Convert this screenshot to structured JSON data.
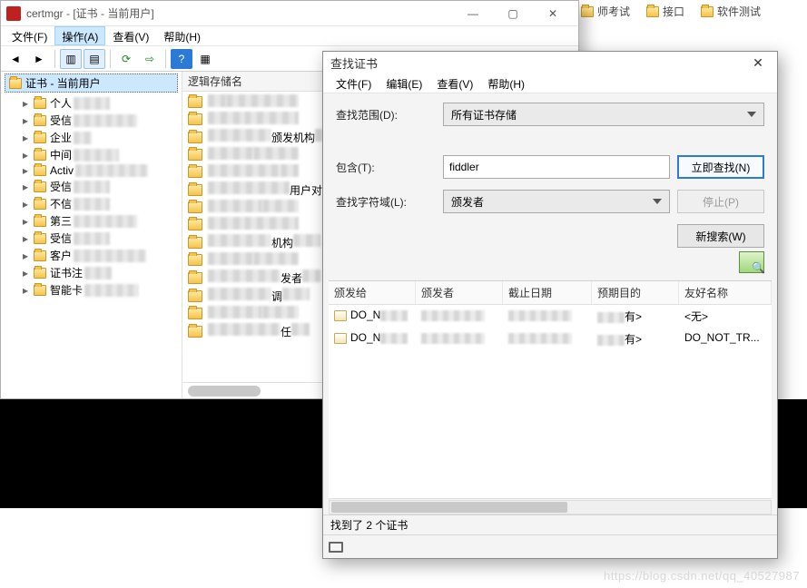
{
  "bookmarks": [
    "师考试",
    "接口",
    "软件测试"
  ],
  "certmgr": {
    "title": "certmgr - [证书 - 当前用户]",
    "menus": {
      "file": "文件(F)",
      "action": "操作(A)",
      "view": "查看(V)",
      "help": "帮助(H)"
    },
    "tree": {
      "root": "证书 - 当前用户",
      "items": [
        "个人",
        "受信",
        "企业",
        "中间",
        "Activ",
        "受信",
        "不信",
        "第三",
        "受信",
        "客户",
        "证书注",
        "智能卡"
      ]
    },
    "list": {
      "header": "逻辑存储名",
      "visible_labels": [
        "颁发机构",
        "用户对象",
        "机构",
        "发者",
        "调",
        "任"
      ]
    }
  },
  "finddlg": {
    "title": "查找证书",
    "menus": {
      "file": "文件(F)",
      "edit": "编辑(E)",
      "view": "查看(V)",
      "help": "帮助(H)"
    },
    "labels": {
      "scope": "查找范围(D):",
      "contains": "包含(T):",
      "field": "查找字符域(L):"
    },
    "scope_value": "所有证书存储",
    "contains_value": "fiddler",
    "field_value": "颁发者",
    "buttons": {
      "find_now": "立即查找(N)",
      "stop": "停止(P)",
      "new_search": "新搜索(W)"
    },
    "columns": {
      "issued_to": "颁发给",
      "issued_by": "颁发者",
      "expire": "截止日期",
      "purpose": "预期目的",
      "friendly": "友好名称"
    },
    "rows": [
      {
        "issued_to": "DO_N",
        "purpose_suffix": "有>",
        "friendly": "<无>"
      },
      {
        "issued_to": "DO_N",
        "purpose_suffix": "有>",
        "friendly": "DO_NOT_TR..."
      }
    ],
    "status": "找到了 2 个证书"
  },
  "watermark": "https://blog.csdn.net/qq_40527987"
}
